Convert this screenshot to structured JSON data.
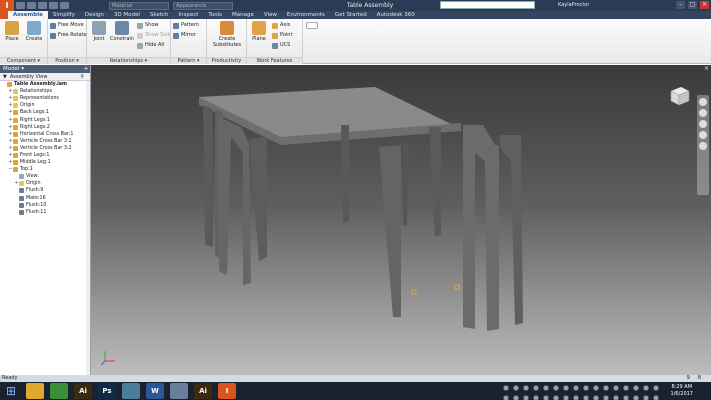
{
  "titlebar": {
    "logo": "I",
    "material": "Material",
    "appearance": "Appearance",
    "document_title": "Table Assembly",
    "user": "KaylaProctor",
    "minimize": "–",
    "maximize": "□",
    "close": "✕"
  },
  "tabs": [
    "Assemble",
    "Simplify",
    "Design",
    "3D Model",
    "Sketch",
    "Inspect",
    "Tools",
    "Manage",
    "View",
    "Environments",
    "Get Started",
    "Autodesk 360"
  ],
  "ribbon": {
    "component": {
      "title": "Component ▾",
      "place": "Place",
      "create": "Create"
    },
    "position": {
      "title": "Position ▾",
      "free_move": "Free Move",
      "free_rotate": "Free Rotate"
    },
    "relationships": {
      "title": "Relationships ▾",
      "joint": "Joint",
      "constrain": "Constrain",
      "show": "Show",
      "show_sick": "Show Sick",
      "hide_all": "Hide All"
    },
    "pattern": {
      "title": "Pattern ▾",
      "pattern": "Pattern",
      "mirror": "Mirror"
    },
    "productivity": {
      "title": "Productivity",
      "create_substitutes": "Create Substitutes"
    },
    "work_features": {
      "title": "Work Features",
      "plane": "Plane",
      "axis": "Axis",
      "point": "Point",
      "ucs": "UCS"
    }
  },
  "browser": {
    "title": "Model ▾",
    "add": "+",
    "view": "Assembly View",
    "items": [
      {
        "label": "Table Assembly.iam",
        "indent": 0,
        "expander": "",
        "icon": "assembly-icon",
        "root": true
      },
      {
        "label": "Relationships",
        "indent": 1,
        "expander": "+",
        "icon": "folder-icon"
      },
      {
        "label": "Representations",
        "indent": 1,
        "expander": "+",
        "icon": "folder-icon"
      },
      {
        "label": "Origin",
        "indent": 1,
        "expander": "+",
        "icon": "folder-icon"
      },
      {
        "label": "Back Legs:1",
        "indent": 1,
        "expander": "+",
        "icon": "part-icon"
      },
      {
        "label": "Right Legs:1",
        "indent": 1,
        "expander": "+",
        "icon": "part-icon"
      },
      {
        "label": "Right Legs:2",
        "indent": 1,
        "expander": "+",
        "icon": "part-icon"
      },
      {
        "label": "Horizontal Cross Bar:1",
        "indent": 1,
        "expander": "+",
        "icon": "part-icon"
      },
      {
        "label": "Verticle Cross Bar 3:1",
        "indent": 1,
        "expander": "+",
        "icon": "part-icon"
      },
      {
        "label": "Verticle Cross Bar 3:2",
        "indent": 1,
        "expander": "+",
        "icon": "part-icon"
      },
      {
        "label": "Front Legs:1",
        "indent": 1,
        "expander": "+",
        "icon": "part-icon"
      },
      {
        "label": "Middle Leg:1",
        "indent": 1,
        "expander": "+",
        "icon": "part-icon"
      },
      {
        "label": "Top:1",
        "indent": 1,
        "expander": "−",
        "icon": "part-icon"
      },
      {
        "label": "View:",
        "indent": 2,
        "expander": "",
        "icon": "view-icon"
      },
      {
        "label": "Origin",
        "indent": 2,
        "expander": "+",
        "icon": "folder-icon"
      },
      {
        "label": "Flush:9",
        "indent": 2,
        "expander": "",
        "icon": "constraint-icon"
      },
      {
        "label": "Mate:16",
        "indent": 2,
        "expander": "",
        "icon": "constraint-icon"
      },
      {
        "label": "Flush:10",
        "indent": 2,
        "expander": "",
        "icon": "constraint-icon"
      },
      {
        "label": "Flush:11",
        "indent": 2,
        "expander": "",
        "icon": "constraint-icon"
      }
    ]
  },
  "viewport": {
    "close": "×",
    "tab_counts": [
      "9",
      "8"
    ]
  },
  "status": {
    "text": "Ready",
    "pages": [
      "9",
      "8"
    ]
  },
  "taskbar": {
    "apps": [
      {
        "label": "",
        "icon": "file-explorer-icon",
        "color": "#e0a82e"
      },
      {
        "label": "",
        "icon": "chrome-icon",
        "color": "#3b8f3a"
      },
      {
        "label": "Ai",
        "icon": "illustrator-icon",
        "color": "#3a2a10"
      },
      {
        "label": "Ps",
        "icon": "photoshop-icon",
        "color": "#0f2a45"
      },
      {
        "label": "",
        "icon": "store-icon",
        "color": "#4a7d9a"
      },
      {
        "label": "W",
        "icon": "word-icon",
        "color": "#2b5797"
      },
      {
        "label": "",
        "icon": "gem-icon",
        "color": "#6a7f99"
      },
      {
        "label": "Ai",
        "icon": "illustrator-icon-2",
        "color": "#3a2a10"
      },
      {
        "label": "I",
        "icon": "inventor-icon",
        "color": "#d9541e"
      }
    ],
    "time": "8:29 AM",
    "date": "1/6/2017"
  },
  "colors": {
    "accent": "#1b5a96",
    "titlebar": "#2a3b55",
    "inventor_orange": "#d9541e"
  }
}
